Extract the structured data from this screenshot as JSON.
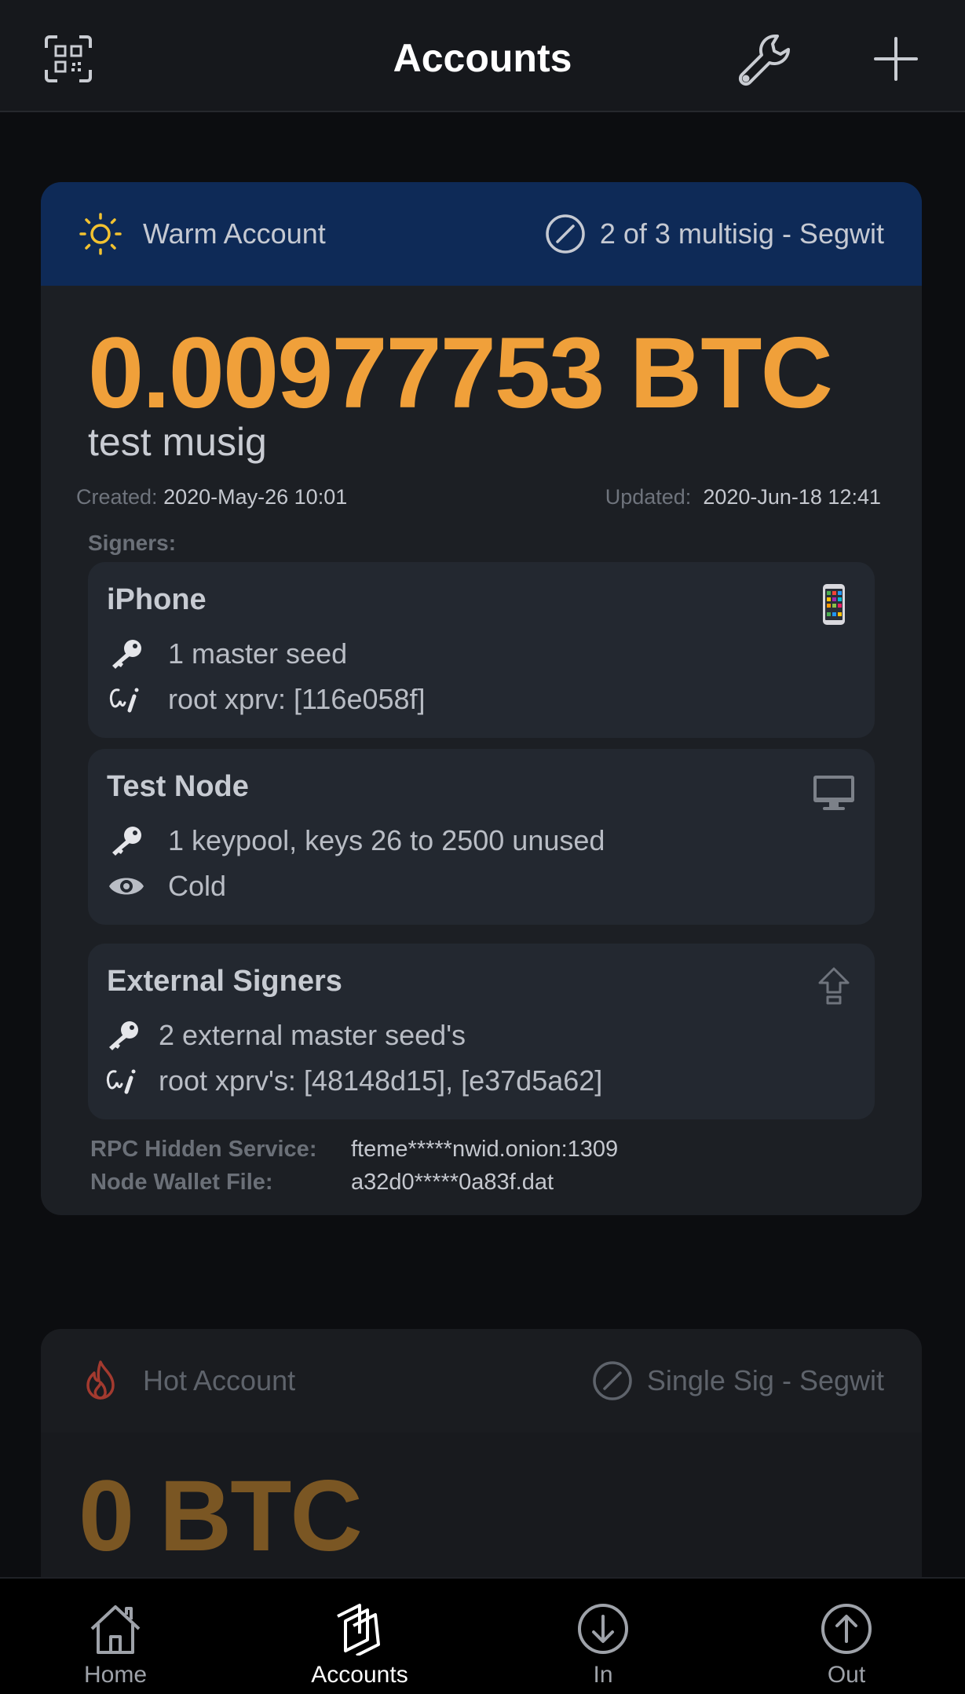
{
  "header": {
    "title": "Accounts"
  },
  "colors": {
    "accent_balance": "#f0a03a",
    "warm_header": "#0e2a57",
    "hot_flame": "#c0392b"
  },
  "warm_account": {
    "type_label": "Warm Account",
    "policy_label": "2 of 3 multisig - Segwit",
    "balance": "0.00977753 BTC",
    "name": "test musig",
    "created_label": "Created:",
    "created_value": "2020-May-26 10:01",
    "updated_label": "Updated:",
    "updated_value": "2020-Jun-18 12:41",
    "signers_label": "Signers:",
    "signers": [
      {
        "title": "iPhone",
        "device_icon": "phone-icon",
        "line1": "1 master seed",
        "line2": "root xprv: [116e058f]"
      },
      {
        "title": "Test Node",
        "device_icon": "desktop-icon",
        "line1": "1 keypool, keys 26 to 2500 unused",
        "line2": "Cold"
      },
      {
        "title": "External Signers",
        "device_icon": "upload-icon",
        "line1": "2 external master seed's",
        "line2": "root xprv's: [48148d15], [e37d5a62]"
      }
    ],
    "rpc_label": "RPC Hidden Service:",
    "rpc_value": "fteme*****nwid.onion:1309",
    "wallet_label": "Node Wallet File:",
    "wallet_value": "a32d0*****0a83f.dat"
  },
  "hot_account": {
    "type_label": "Hot Account",
    "policy_label": "Single Sig - Segwit",
    "balance": "0 BTC"
  },
  "tabs": [
    {
      "label": "Home",
      "icon": "home-icon"
    },
    {
      "label": "Accounts",
      "icon": "accounts-icon",
      "active": true
    },
    {
      "label": "In",
      "icon": "arrow-down-circle-icon"
    },
    {
      "label": "Out",
      "icon": "arrow-up-circle-icon"
    }
  ]
}
